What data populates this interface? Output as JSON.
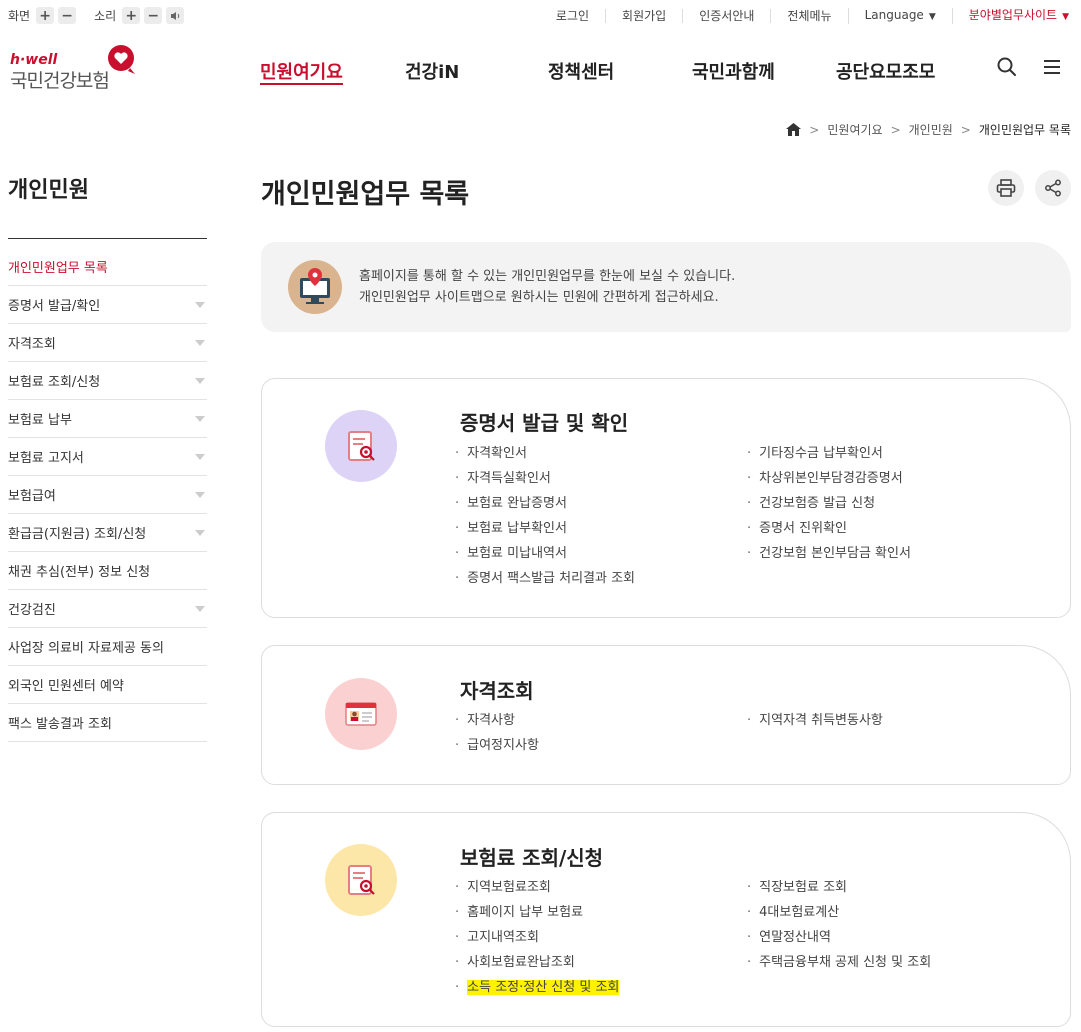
{
  "util": {
    "screen_label": "화면",
    "sound_label": "소리",
    "links": [
      "로그인",
      "회원가입",
      "인증서안내",
      "전체메뉴",
      "Language"
    ],
    "site_link": "분야별업무사이트"
  },
  "logo": {
    "hwell": "h·well",
    "name": "국민건강보험"
  },
  "gnb": [
    "민원여기요",
    "건강iN",
    "정책센터",
    "국민과함께",
    "공단요모조모"
  ],
  "breadcrumb": [
    "민원여기요",
    "개인민원",
    "개인민원업무 목록"
  ],
  "sidebar": {
    "title": "개인민원",
    "items": [
      {
        "label": "개인민원업무 목록",
        "active": true,
        "expand": false
      },
      {
        "label": "증명서 발급/확인",
        "expand": true
      },
      {
        "label": "자격조회",
        "expand": true
      },
      {
        "label": "보험료 조회/신청",
        "expand": true
      },
      {
        "label": "보험료 납부",
        "expand": true
      },
      {
        "label": "보험료 고지서",
        "expand": true
      },
      {
        "label": "보험급여",
        "expand": true
      },
      {
        "label": "환급금(지원금) 조회/신청",
        "expand": true
      },
      {
        "label": "채권 추심(전부) 정보 신청",
        "expand": false
      },
      {
        "label": "건강검진",
        "expand": true
      },
      {
        "label": "사업장 의료비 자료제공 동의",
        "expand": false
      },
      {
        "label": "외국인 민원센터 예약",
        "expand": false
      },
      {
        "label": "팩스 발송결과 조회",
        "expand": false
      }
    ]
  },
  "main": {
    "title": "개인민원업무 목록",
    "info_line1": "홈페이지를 통해 할 수 있는 개인민원업무를 한눈에 보실 수 있습니다.",
    "info_line2": "개인민원업무 사이트맵으로 원하시는 민원에 간편하게 접근하세요."
  },
  "cards": [
    {
      "title": "증명서 발급 및 확인",
      "icon": "document-search-icon",
      "left": [
        "자격확인서",
        "자격득실확인서",
        "보험료 완납증명서",
        "보험료 납부확인서",
        "보험료 미납내역서",
        "증명서 팩스발급 처리결과 조회"
      ],
      "right": [
        "기타징수금 납부확인서",
        "차상위본인부담경감증명서",
        "건강보험증 발급 신청",
        "증명서 진위확인",
        "건강보험 본인부담금 확인서"
      ]
    },
    {
      "title": "자격조회",
      "icon": "id-card-icon",
      "left": [
        "자격사항",
        "급여정지사항"
      ],
      "right": [
        "지역자격 취득변동사항"
      ]
    },
    {
      "title": "보험료 조회/신청",
      "icon": "document-search-icon",
      "left": [
        "지역보험료조회",
        "홈페이지 납부 보험료",
        "고지내역조회",
        "사회보험료완납조회",
        "소득 조정·정산 신청 및 조회"
      ],
      "right": [
        "직장보험료 조회",
        "4대보험료계산",
        "연말정산내역",
        "주택금융부채 공제 신청 및 조회"
      ]
    }
  ],
  "colors": {
    "brand": "#c8102e",
    "card1": "#ddd3f6",
    "card2": "#fbd0d0",
    "card3": "#fde7a8",
    "highlight": "#fff200"
  }
}
